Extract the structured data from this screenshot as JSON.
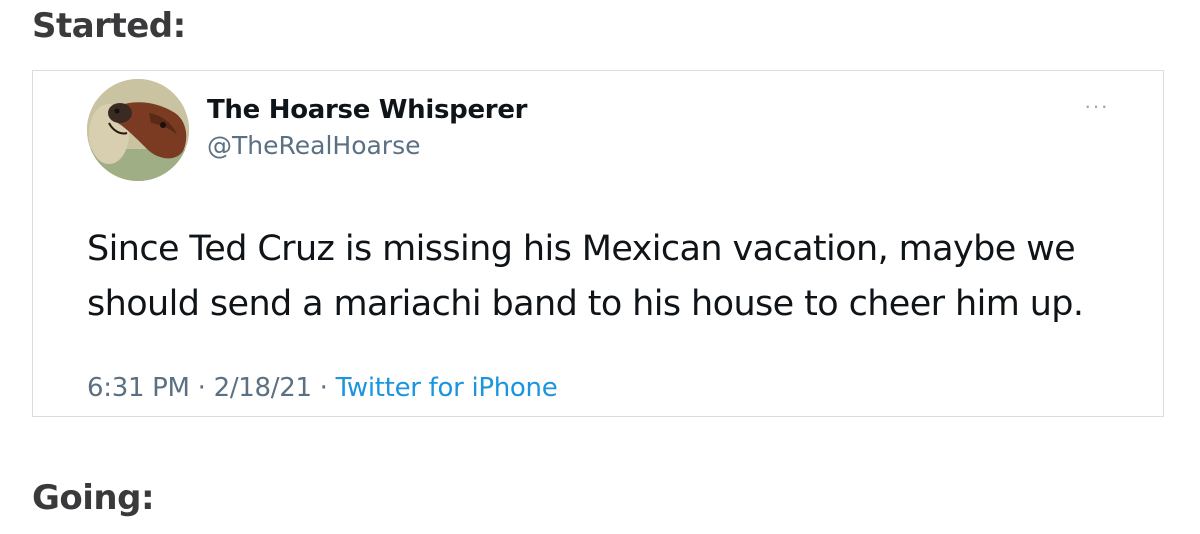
{
  "headings": {
    "started": "Started:",
    "going": "Going:"
  },
  "tweet": {
    "display_name": "The Hoarse Whisperer",
    "handle": "@TheRealHoarse",
    "more_icon": "more-horizontal-icon",
    "more_glyph": "···",
    "text": "Since Ted Cruz is missing his Mexican vacation, maybe we should send a mariachi band to his house to cheer him up.",
    "time": "6:31 PM",
    "separator": " · ",
    "date": "2/18/21",
    "source": "Twitter for iPhone"
  },
  "colors": {
    "heading": "#3a3a3c",
    "name": "#0f1419",
    "secondary": "#5b7083",
    "link": "#1b95e0",
    "border": "#d9dde1"
  }
}
